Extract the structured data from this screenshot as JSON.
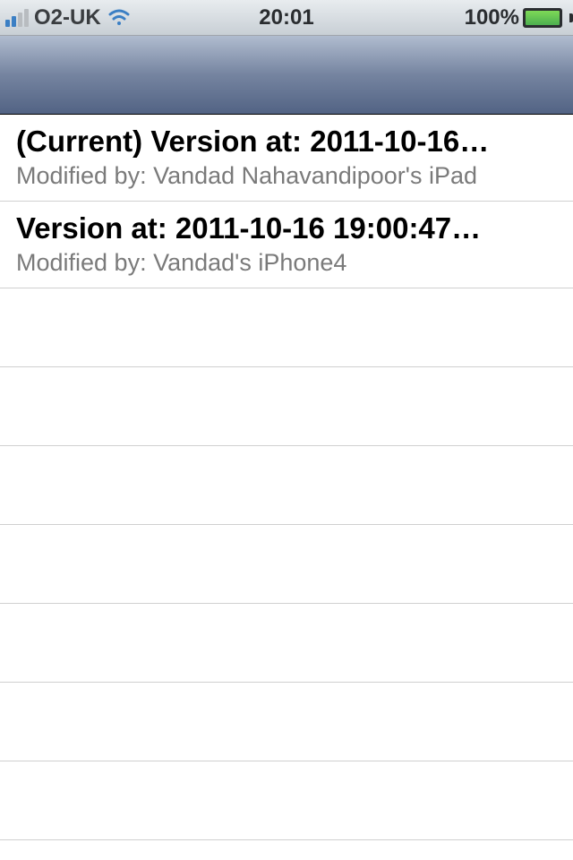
{
  "statusBar": {
    "carrier": "O2-UK",
    "time": "20:01",
    "batteryPercent": "100%"
  },
  "versions": [
    {
      "title": "(Current) Version at: 2011-10-16…",
      "subtitle": "Modified by: Vandad Nahavandipoor's iPad"
    },
    {
      "title": "Version at: 2011-10-16 19:00:47…",
      "subtitle": "Modified by: Vandad's iPhone4"
    }
  ]
}
